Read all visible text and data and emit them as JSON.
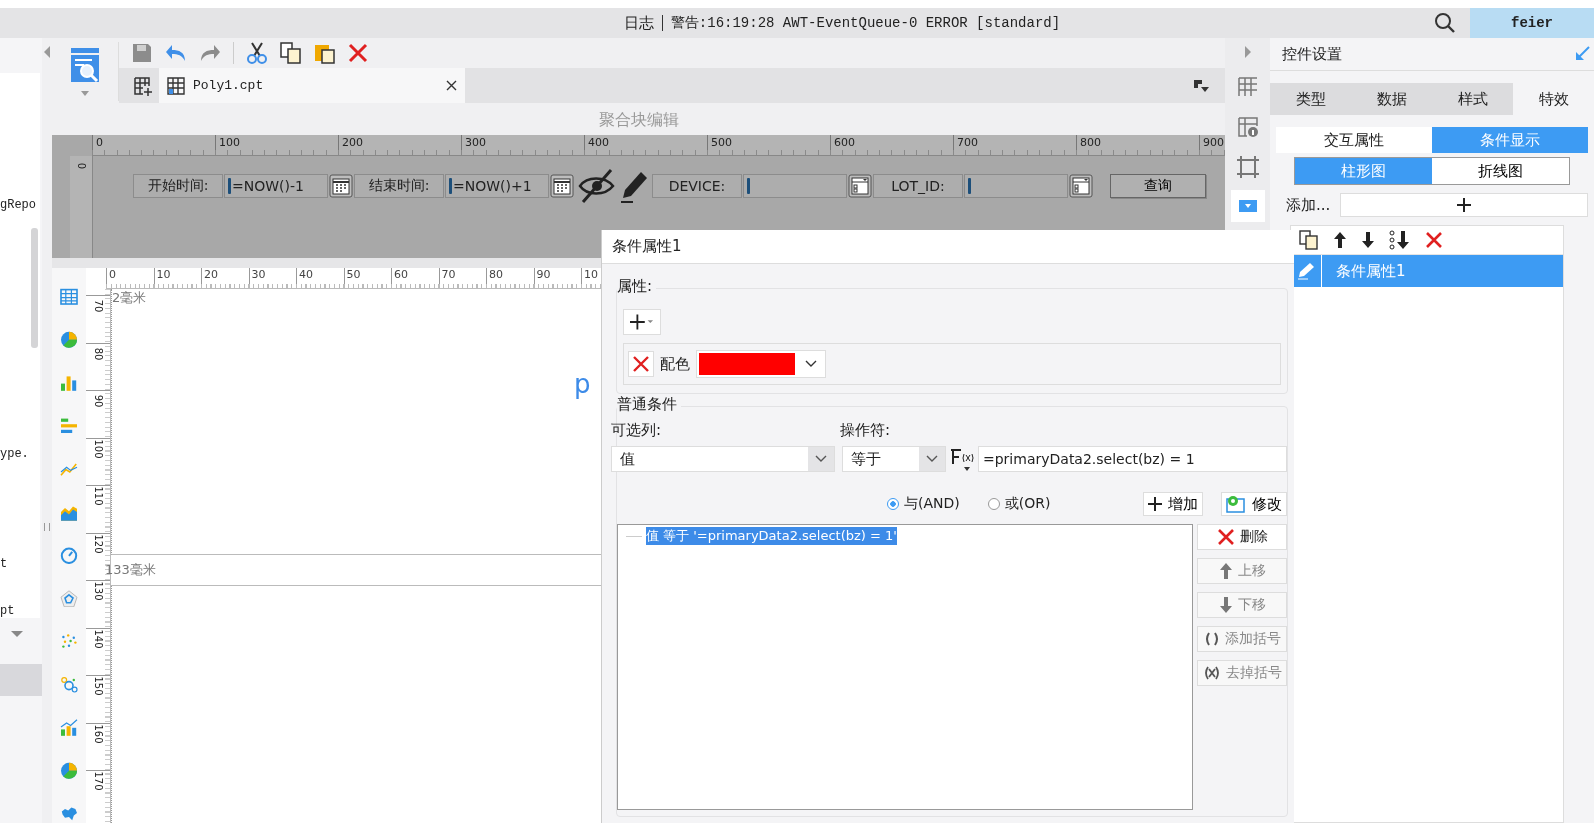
{
  "title_bar": {
    "log_label": "日志",
    "warning": "警告:16:19:28 AWT-EventQueue-0 ERROR [standard]",
    "user": "feier"
  },
  "left_panel": {
    "fragments": [
      "gRepo",
      "ype.",
      "t",
      "pt"
    ]
  },
  "file_tab": {
    "name": "Poly1.cpt"
  },
  "block_editor": {
    "title": "聚合块编辑",
    "ruler_labels": [
      "0",
      "100",
      "200",
      "300",
      "400",
      "500",
      "600",
      "700",
      "800",
      "900"
    ],
    "vertical_ruler_label": "0",
    "params": [
      {
        "kind": "label",
        "text": "开始时间:"
      },
      {
        "kind": "field",
        "value": "=NOW()-1"
      },
      {
        "kind": "date"
      },
      {
        "kind": "label",
        "text": "结束时间:"
      },
      {
        "kind": "field",
        "value": "=NOW()+1"
      },
      {
        "kind": "date"
      },
      {
        "kind": "label",
        "text": "DEVICE:"
      },
      {
        "kind": "field"
      },
      {
        "kind": "combo"
      },
      {
        "kind": "label",
        "text": "LOT_ID:"
      },
      {
        "kind": "field"
      },
      {
        "kind": "combo"
      },
      {
        "kind": "button",
        "text": "查询"
      }
    ]
  },
  "report_editor": {
    "ruler_labels": [
      "0",
      "10",
      "20",
      "30",
      "40",
      "50",
      "60",
      "70",
      "80",
      "90",
      "10"
    ],
    "vertical_labels": [
      "70",
      "80",
      "90",
      "100",
      "110",
      "120",
      "130",
      "140",
      "150",
      "160",
      "170"
    ],
    "top_margin": "2毫米",
    "bottom_margin": "133毫米",
    "cut_text": "p"
  },
  "control_settings": {
    "title": "控件设置",
    "tabs": [
      {
        "label": "类型",
        "selected": false
      },
      {
        "label": "数据",
        "selected": false
      },
      {
        "label": "样式",
        "selected": false
      },
      {
        "label": "特效",
        "selected": true
      }
    ],
    "subtabs": [
      {
        "label": "交互属性",
        "selected": false
      },
      {
        "label": "条件显示",
        "selected": true
      }
    ],
    "chart_tabs": [
      {
        "label": "柱形图",
        "selected": true
      },
      {
        "label": "折线图",
        "selected": false
      }
    ],
    "add_label": "添加...",
    "items": [
      {
        "label": "条件属性1",
        "selected": true
      }
    ]
  },
  "dialog": {
    "title": "条件属性1",
    "attributes_label": "属性:",
    "color_label": "配色",
    "color": "#ff0000",
    "conditions_label": "普通条件",
    "column_label": "可选列:",
    "column_value": "值",
    "operator_label": "操作符:",
    "operator_value": "等于",
    "formula": "=primaryData2.select(bz) = 1",
    "logic": [
      {
        "label": "与(AND)",
        "selected": true
      },
      {
        "label": "或(OR)",
        "selected": false
      }
    ],
    "add_button": "增加",
    "modify_button": "修改",
    "conditions": [
      {
        "text": "值 等于 '=primaryData2.select(bz) = 1'",
        "selected": true
      }
    ],
    "side_buttons": [
      {
        "kind": "delete",
        "label": "删除",
        "disabled": false
      },
      {
        "kind": "up",
        "label": "上移",
        "disabled": true
      },
      {
        "kind": "down",
        "label": "下移",
        "disabled": true
      },
      {
        "kind": "add-bracket",
        "label": "添加括号",
        "disabled": true
      },
      {
        "kind": "remove-bracket",
        "label": "去掉括号",
        "disabled": true
      }
    ]
  }
}
